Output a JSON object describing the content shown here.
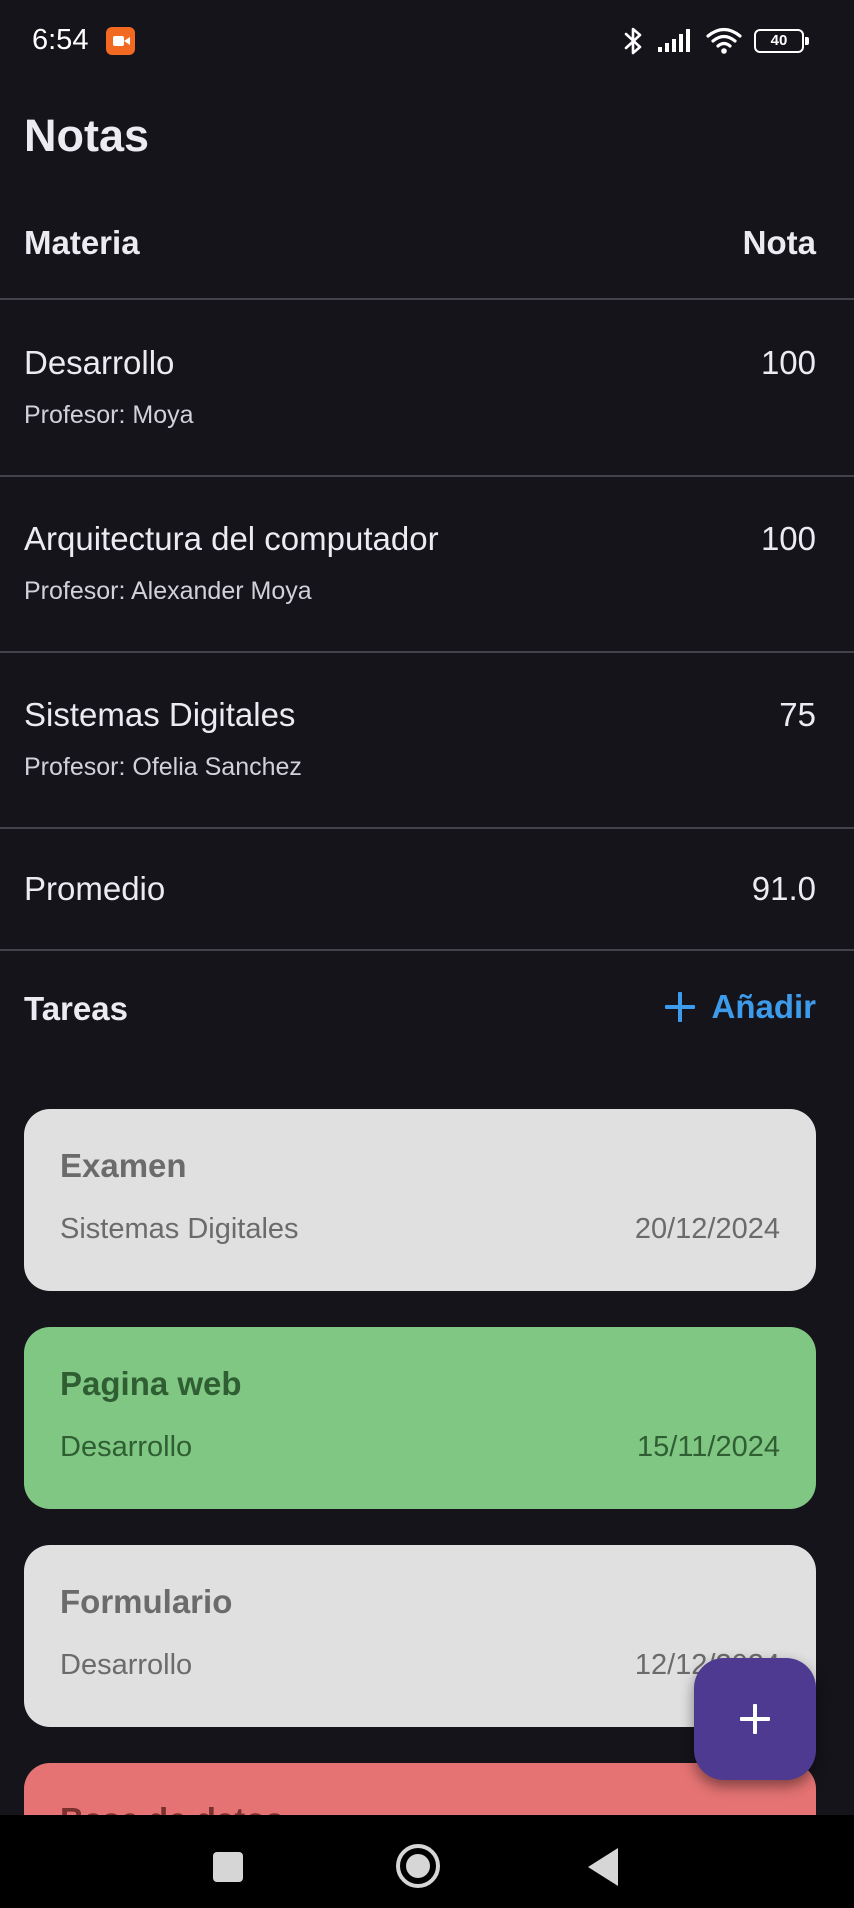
{
  "status_bar": {
    "time": "6:54",
    "battery_level": "40",
    "icons": [
      "screen-record-icon",
      "bluetooth-icon",
      "signal-icon",
      "wifi-icon",
      "battery-icon"
    ]
  },
  "app_title": "Notas",
  "grades_table": {
    "header_subject": "Materia",
    "header_grade": "Nota",
    "rows": [
      {
        "subject": "Desarrollo",
        "professor": "Profesor: Moya",
        "grade": "100"
      },
      {
        "subject": "Arquitectura del computador",
        "professor": "Profesor: Alexander Moya",
        "grade": "100"
      },
      {
        "subject": "Sistemas Digitales",
        "professor": "Profesor: Ofelia Sanchez",
        "grade": "75"
      }
    ],
    "average_label": "Promedio",
    "average_value": "91.0"
  },
  "tasks": {
    "heading": "Tareas",
    "add_label": "Añadir",
    "items": [
      {
        "title": "Examen",
        "subject": "Sistemas Digitales",
        "date": "20/12/2024",
        "bg": "#e0e0e0",
        "fg": "#6b6b6b"
      },
      {
        "title": "Pagina web",
        "subject": "Desarrollo",
        "date": "15/11/2024",
        "bg": "#81c784",
        "fg": "#2f5e33"
      },
      {
        "title": "Formulario",
        "subject": "Desarrollo",
        "date": "12/12/2024",
        "bg": "#e0e0e0",
        "fg": "#6b6b6b"
      },
      {
        "title": "Base de datos",
        "subject": "",
        "date": "",
        "bg": "#e57373",
        "fg": "#7a2f2f"
      }
    ]
  },
  "colors": {
    "background": "#15141b",
    "accent": "#3d9bec",
    "fab": "#4e3a91",
    "divider": "#44434c"
  }
}
